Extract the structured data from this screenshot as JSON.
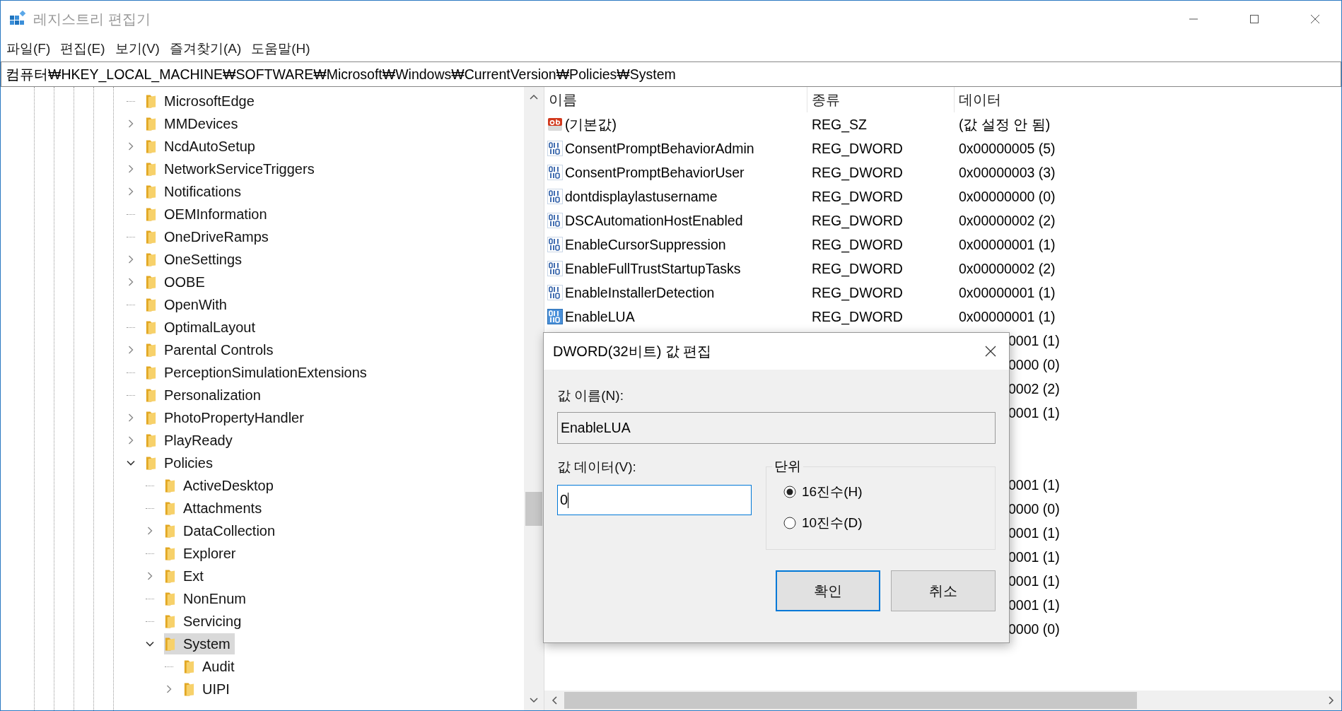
{
  "window": {
    "title": "레지스트리 편집기"
  },
  "menu": [
    "파일(F)",
    "편집(E)",
    "보기(V)",
    "즐겨찾기(A)",
    "도움말(H)"
  ],
  "address": "컴퓨터₩HKEY_LOCAL_MACHINE₩SOFTWARE₩Microsoft₩Windows₩CurrentVersion₩Policies₩System",
  "tree": {
    "items": [
      {
        "label": "MicrosoftEdge",
        "has_children": false,
        "selected": false
      },
      {
        "label": "MMDevices",
        "has_children": true,
        "expanded": false,
        "selected": false
      },
      {
        "label": "NcdAutoSetup",
        "has_children": true,
        "expanded": false,
        "selected": false
      },
      {
        "label": "NetworkServiceTriggers",
        "has_children": true,
        "expanded": false,
        "selected": false
      },
      {
        "label": "Notifications",
        "has_children": true,
        "expanded": false,
        "selected": false
      },
      {
        "label": "OEMInformation",
        "has_children": false,
        "selected": false
      },
      {
        "label": "OneDriveRamps",
        "has_children": false,
        "selected": false
      },
      {
        "label": "OneSettings",
        "has_children": true,
        "expanded": false,
        "selected": false
      },
      {
        "label": "OOBE",
        "has_children": true,
        "expanded": false,
        "selected": false
      },
      {
        "label": "OpenWith",
        "has_children": false,
        "selected": false
      },
      {
        "label": "OptimalLayout",
        "has_children": false,
        "selected": false
      },
      {
        "label": "Parental Controls",
        "has_children": true,
        "expanded": false,
        "selected": false
      },
      {
        "label": "PerceptionSimulationExtensions",
        "has_children": false,
        "selected": false
      },
      {
        "label": "Personalization",
        "has_children": false,
        "selected": false
      },
      {
        "label": "PhotoPropertyHandler",
        "has_children": true,
        "expanded": false,
        "selected": false
      },
      {
        "label": "PlayReady",
        "has_children": true,
        "expanded": false,
        "selected": false
      },
      {
        "label": "Policies",
        "has_children": true,
        "expanded": true,
        "selected": false,
        "children": [
          {
            "label": "ActiveDesktop",
            "has_children": false,
            "selected": false
          },
          {
            "label": "Attachments",
            "has_children": false,
            "selected": false
          },
          {
            "label": "DataCollection",
            "has_children": true,
            "expanded": false,
            "selected": false
          },
          {
            "label": "Explorer",
            "has_children": false,
            "selected": false
          },
          {
            "label": "Ext",
            "has_children": true,
            "expanded": false,
            "selected": false
          },
          {
            "label": "NonEnum",
            "has_children": false,
            "selected": false
          },
          {
            "label": "Servicing",
            "has_children": false,
            "selected": false
          },
          {
            "label": "System",
            "has_children": true,
            "expanded": true,
            "selected": true,
            "children": [
              {
                "label": "Audit",
                "has_children": false,
                "selected": false
              },
              {
                "label": "UIPI",
                "has_children": true,
                "expanded": false,
                "selected": false
              }
            ]
          }
        ]
      }
    ]
  },
  "values": {
    "columns": [
      "이름",
      "종류",
      "데이터"
    ],
    "rows": [
      {
        "kind": "string",
        "name": "(기본값)",
        "type": "REG_SZ",
        "data": "(값 설정 안 됨)",
        "selected": false
      },
      {
        "kind": "dword",
        "name": "ConsentPromptBehaviorAdmin",
        "type": "REG_DWORD",
        "data": "0x00000005 (5)",
        "selected": false
      },
      {
        "kind": "dword",
        "name": "ConsentPromptBehaviorUser",
        "type": "REG_DWORD",
        "data": "0x00000003 (3)",
        "selected": false
      },
      {
        "kind": "dword",
        "name": "dontdisplaylastusername",
        "type": "REG_DWORD",
        "data": "0x00000000 (0)",
        "selected": false
      },
      {
        "kind": "dword",
        "name": "DSCAutomationHostEnabled",
        "type": "REG_DWORD",
        "data": "0x00000002 (2)",
        "selected": false
      },
      {
        "kind": "dword",
        "name": "EnableCursorSuppression",
        "type": "REG_DWORD",
        "data": "0x00000001 (1)",
        "selected": false
      },
      {
        "kind": "dword",
        "name": "EnableFullTrustStartupTasks",
        "type": "REG_DWORD",
        "data": "0x00000002 (2)",
        "selected": false
      },
      {
        "kind": "dword",
        "name": "EnableInstallerDetection",
        "type": "REG_DWORD",
        "data": "0x00000001 (1)",
        "selected": false
      },
      {
        "kind": "dword",
        "name": "EnableLUA",
        "type": "REG_DWORD",
        "data": "0x00000001 (1)",
        "selected": true
      },
      {
        "kind": "hidden",
        "data": "0001 (1)"
      },
      {
        "kind": "hidden",
        "data": "0000 (0)"
      },
      {
        "kind": "hidden",
        "data": "0002 (2)"
      },
      {
        "kind": "hidden",
        "data": "0001 (1)"
      },
      {
        "kind": "hidden"
      },
      {
        "kind": "hidden"
      },
      {
        "kind": "hidden",
        "data": "0001 (1)"
      },
      {
        "kind": "hidden",
        "data": "0000 (0)"
      },
      {
        "kind": "hidden",
        "data": "0001 (1)"
      },
      {
        "kind": "hidden",
        "data": "0001 (1)"
      },
      {
        "kind": "hidden",
        "data": "0001 (1)"
      },
      {
        "kind": "hidden",
        "data": "0001 (1)"
      },
      {
        "kind": "hidden",
        "data": "0000 (0)"
      }
    ]
  },
  "dialog": {
    "title": "DWORD(32비트) 값 편집",
    "name_label": "값 이름(N):",
    "name_value": "EnableLUA",
    "data_label": "값 데이터(V):",
    "data_value": "0",
    "base_group": "단위",
    "bases": [
      {
        "label": "16진수(H)",
        "selected": true
      },
      {
        "label": "10진수(D)",
        "selected": false
      }
    ],
    "buttons": [
      {
        "label": "확인",
        "default": true
      },
      {
        "label": "취소",
        "default": false
      }
    ]
  }
}
